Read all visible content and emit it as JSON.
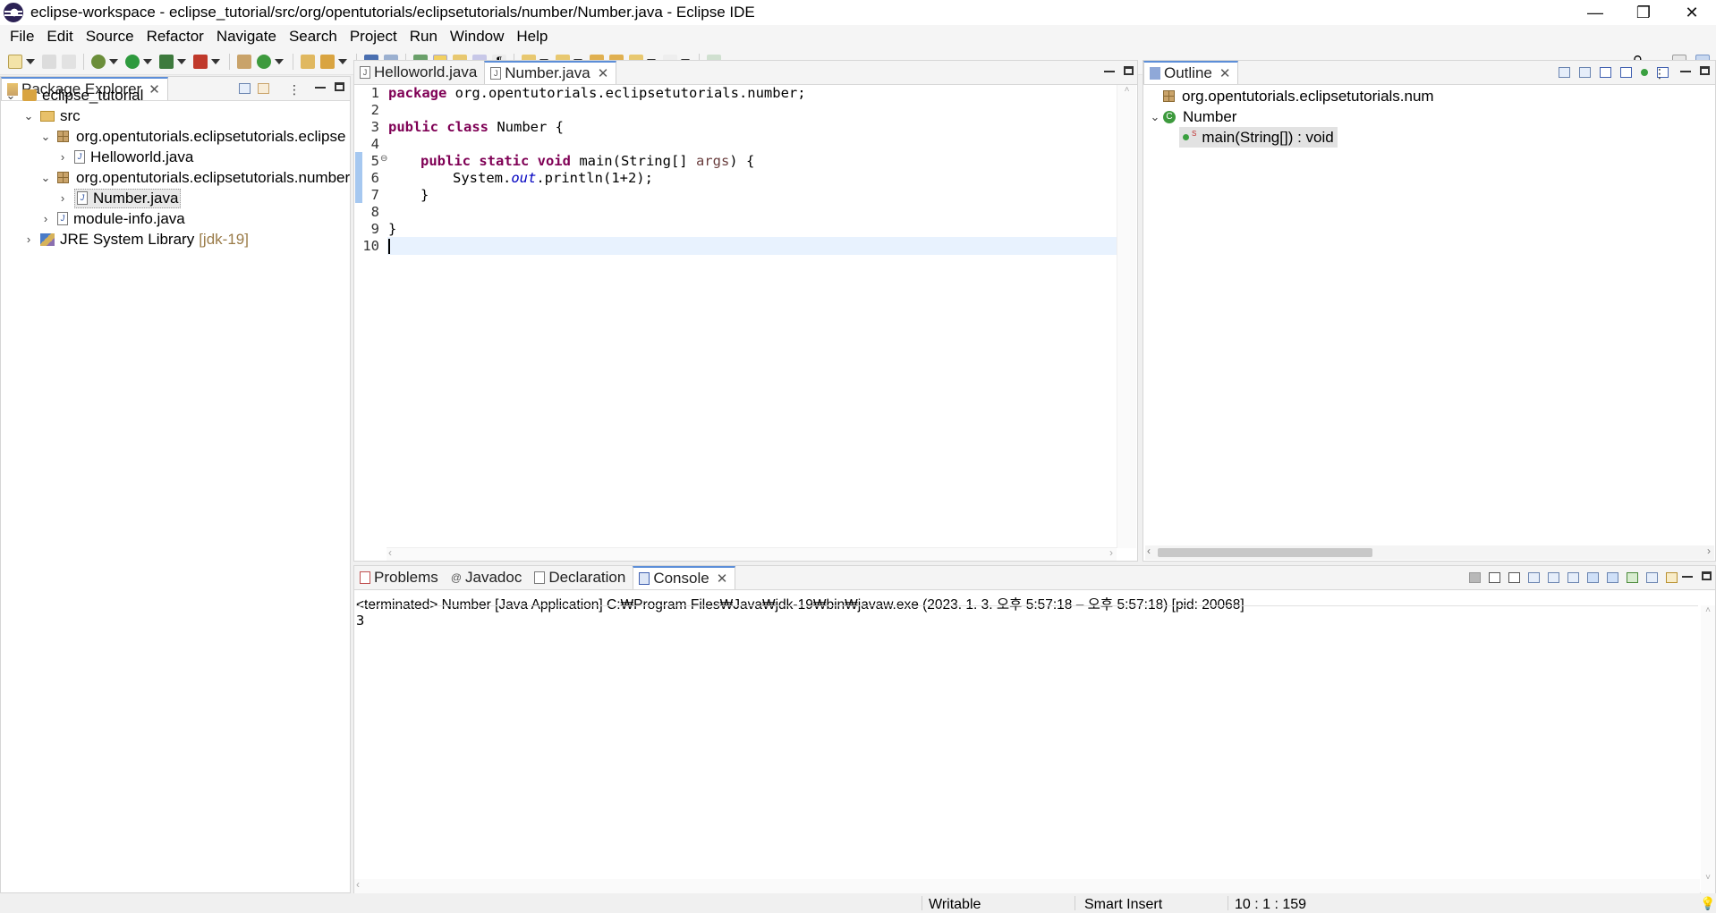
{
  "window": {
    "title": "eclipse-workspace - eclipse_tutorial/src/org/opentutorials/eclipsetutorials/number/Number.java - Eclipse IDE",
    "controls": [
      "—",
      "❐",
      "✕"
    ]
  },
  "menu": [
    "File",
    "Edit",
    "Source",
    "Refactor",
    "Navigate",
    "Search",
    "Project",
    "Run",
    "Window",
    "Help"
  ],
  "package_explorer": {
    "tab_label": "Package Explorer",
    "tree": {
      "project": "eclipse_tutorial",
      "src": "src",
      "pkg1": "org.opentutorials.eclipsetutorials.eclipse",
      "file1": "Helloworld.java",
      "pkg2": "org.opentutorials.eclipsetutorials.number",
      "file2": "Number.java",
      "module": "module-info.java",
      "jre": "JRE System Library",
      "jre_version": "[jdk-19]"
    }
  },
  "editor": {
    "tabs": [
      "Helloworld.java",
      "Number.java"
    ],
    "line_numbers": [
      "1",
      "2",
      "3",
      "4",
      "5",
      "6",
      "7",
      "8",
      "9",
      "10"
    ],
    "code": {
      "l1_kw": "package",
      "l1_rest": " org.opentutorials.eclipsetutorials.number;",
      "l3_kw1": "public",
      "l3_kw2": "class",
      "l3_rest": " Number {",
      "l5_kw": "public static void",
      "l5_mid": " main(String[] ",
      "l5_var": "args",
      "l5_end": ") {",
      "l6_a": "System.",
      "l6_fld": "out",
      "l6_b": ".println(1+2);",
      "l7": "}",
      "l9": "}"
    }
  },
  "outline": {
    "tab_label": "Outline",
    "package": "org.opentutorials.eclipsetutorials.num",
    "class": "Number",
    "method": "main(String[]) : void"
  },
  "console": {
    "tabs": [
      "Problems",
      "Javadoc",
      "Declaration",
      "Console"
    ],
    "header": "<terminated> Number [Java Application] C:₩Program Files₩Java₩jdk-19₩bin₩javaw.exe  (2023. 1. 3. 오후 5:57:18 – 오후 5:57:18) [pid: 20068]",
    "output": "3"
  },
  "status": {
    "writable": "Writable",
    "insert_mode": "Smart Insert",
    "position": "10 : 1 : 159"
  }
}
